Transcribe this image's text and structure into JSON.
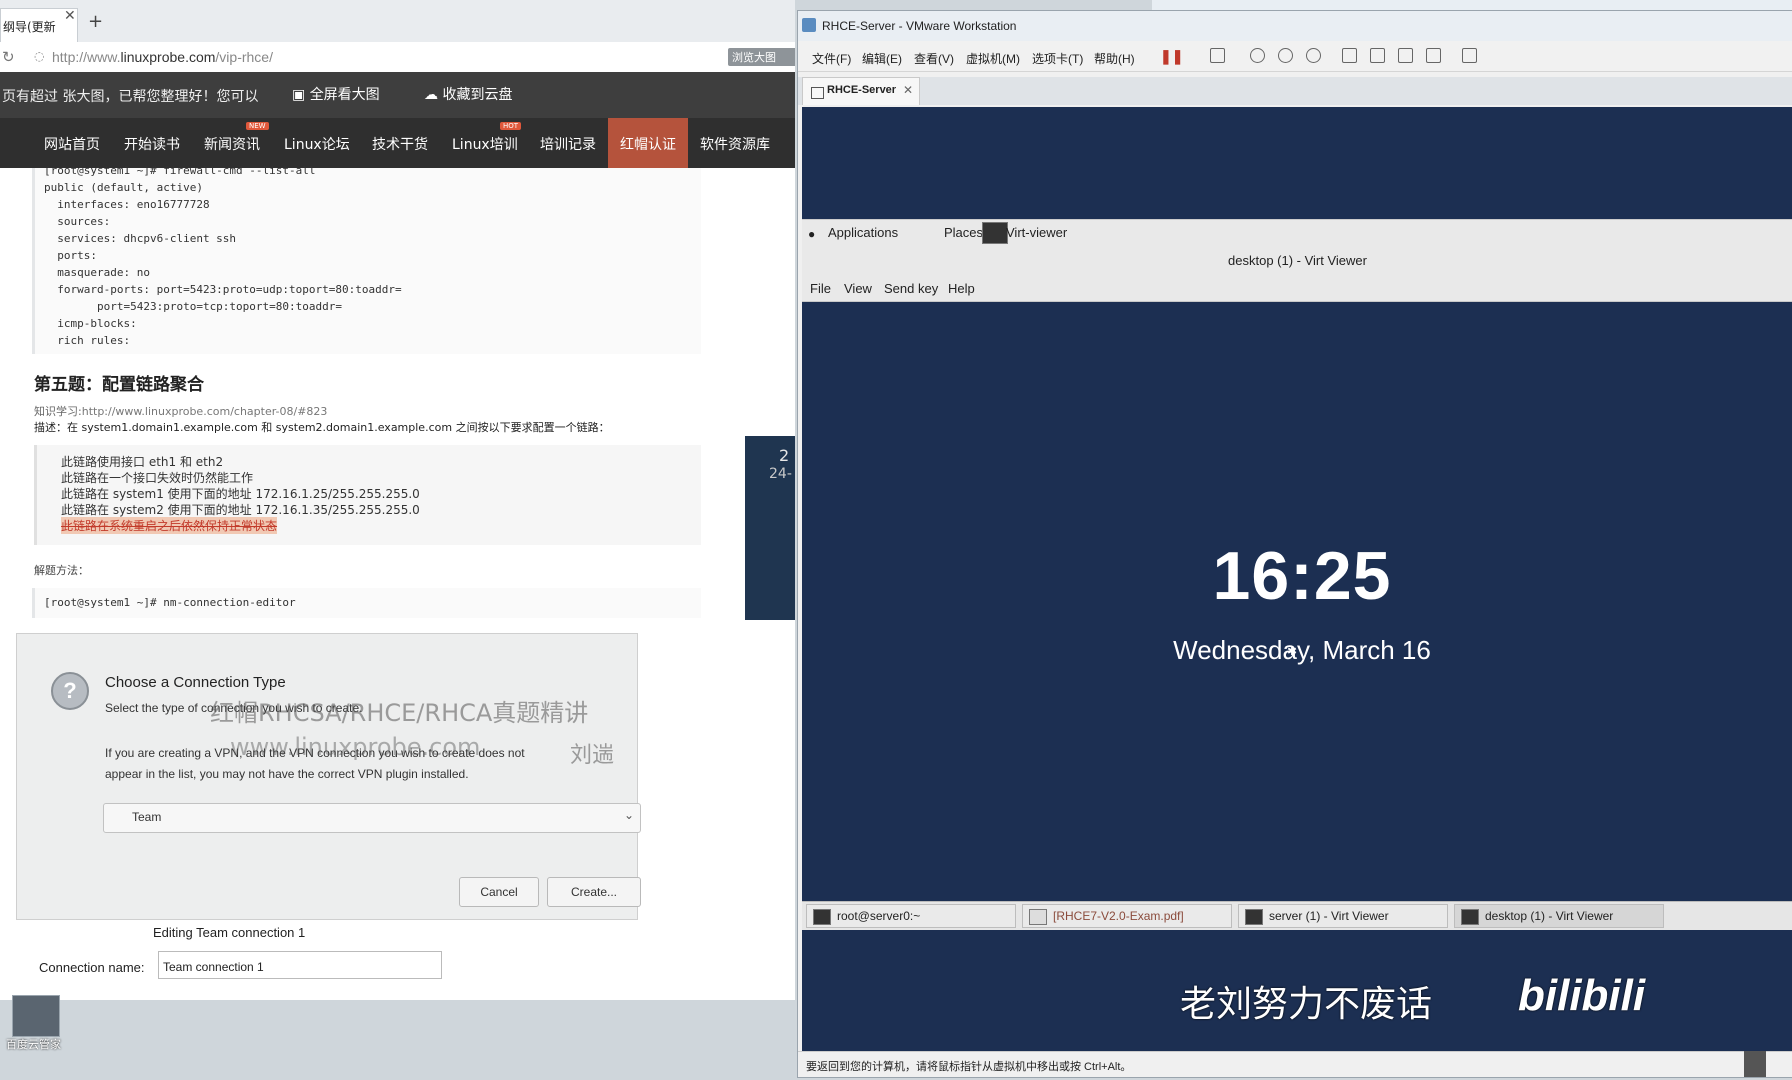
{
  "browser": {
    "tab_title": "纲导(更新",
    "new_tab": "+",
    "url_prefix": "http://www.",
    "url_domain": "linuxprobe.com",
    "url_path": "/vip-rhce/",
    "badge_right": "浏览大图",
    "image_bar_text": "页有超过 张大图，已帮您整理好！您可以",
    "image_full_view": "全屏看大图",
    "image_cloud_save": "收藏到云盘",
    "nav": [
      {
        "label": "网站首页"
      },
      {
        "label": "开始读书"
      },
      {
        "label": "新闻资讯",
        "badge": "NEW"
      },
      {
        "label": "Linux论坛"
      },
      {
        "label": "技术干货"
      },
      {
        "label": "Linux培训",
        "badge": "HOT"
      },
      {
        "label": "培训记录"
      },
      {
        "label": "红帽认证"
      },
      {
        "label": "软件资源库"
      }
    ]
  },
  "code_block_1": [
    "[root@system1 ~]# firewall-cmd --list-all",
    "public (default, active)",
    "  interfaces: eno16777728",
    "  sources:",
    "  services: dhcpv6-client ssh",
    "  ports:",
    "  masquerade: no",
    "  forward-ports: port=5423:proto=udp:toport=80:toaddr=",
    "        port=5423:proto=tcp:toport=80:toaddr=",
    "  icmp-blocks:",
    "  rich rules:"
  ],
  "section": {
    "heading": "第五题：配置链路聚合",
    "knowledge_prefix": "知识学习:",
    "knowledge_link": "http://www.linuxprobe.com/chapter-08/#823",
    "description": "描述：在 system1.domain1.example.com 和 system2.domain1.example.com 之间按以下要求配置一个链路：",
    "requirements": [
      "此链路使用接口 eth1 和 eth2",
      "此链路在一个接口失效时仍然能工作",
      "此链路在 system1 使用下面的地址 172.16.1.25/255.255.255.0",
      "此链路在 system2 使用下面的地址 172.16.1.35/255.255.255.0",
      "此链路在系统重启之后依然保持正常状态"
    ],
    "solve_label": "解题方法：",
    "command": "[root@system1 ~]# nm-connection-editor"
  },
  "dialog": {
    "title": "Choose a Connection Type",
    "subtitle": "Select the type of connection you wish to create.",
    "para1": "If you are creating a VPN, and the VPN connection you wish to create does not",
    "para2": "appear in the list, you may not have the correct VPN plugin installed.",
    "selected_type": "Team",
    "cancel": "Cancel",
    "create": "Create..."
  },
  "editing": {
    "title": "Editing Team connection 1",
    "name_label": "Connection name:",
    "name_value": "Team connection 1"
  },
  "watermarks": {
    "line1": "红帽RHCSA/RHCE/RHCA真题精讲",
    "line2": "www.linuxprobe.com",
    "author": "刘遄",
    "bottom": "老刘努力不废话",
    "logo": "bilibili"
  },
  "photo_text": {
    "line1": "2",
    "line2": "24-"
  },
  "desktop_icon_label": "百度云管家",
  "vmware": {
    "title": "RHCE-Server - VMware Workstation",
    "menu": [
      "文件(F)",
      "编辑(E)",
      "查看(V)",
      "虚拟机(M)",
      "选项卡(T)",
      "帮助(H)"
    ],
    "tab": "RHCE-Server",
    "status": "要返回到您的计算机，请将鼠标指针从虚拟机中移出或按 Ctrl+Alt。"
  },
  "guest": {
    "gnome_apps": "Applications",
    "gnome_places": "Places",
    "gnome_window": "Virt-viewer",
    "viewer_title": "desktop (1) - Virt Viewer",
    "viewer_menu": [
      "File",
      "View",
      "Send key",
      "Help"
    ],
    "lock_time": "16:25",
    "lock_date": "Wednesday, March 16",
    "taskbar": [
      "root@server0:~",
      "[RHCE7-V2.0-Exam.pdf]",
      "server (1) - Virt Viewer",
      "desktop (1) - Virt Viewer"
    ]
  },
  "colors": {
    "nav_bg": "#2f2f2f",
    "nav_active": "#b5533c",
    "guest_bg": "#1c2f52",
    "strike_highlight": "#f1c9b4"
  }
}
